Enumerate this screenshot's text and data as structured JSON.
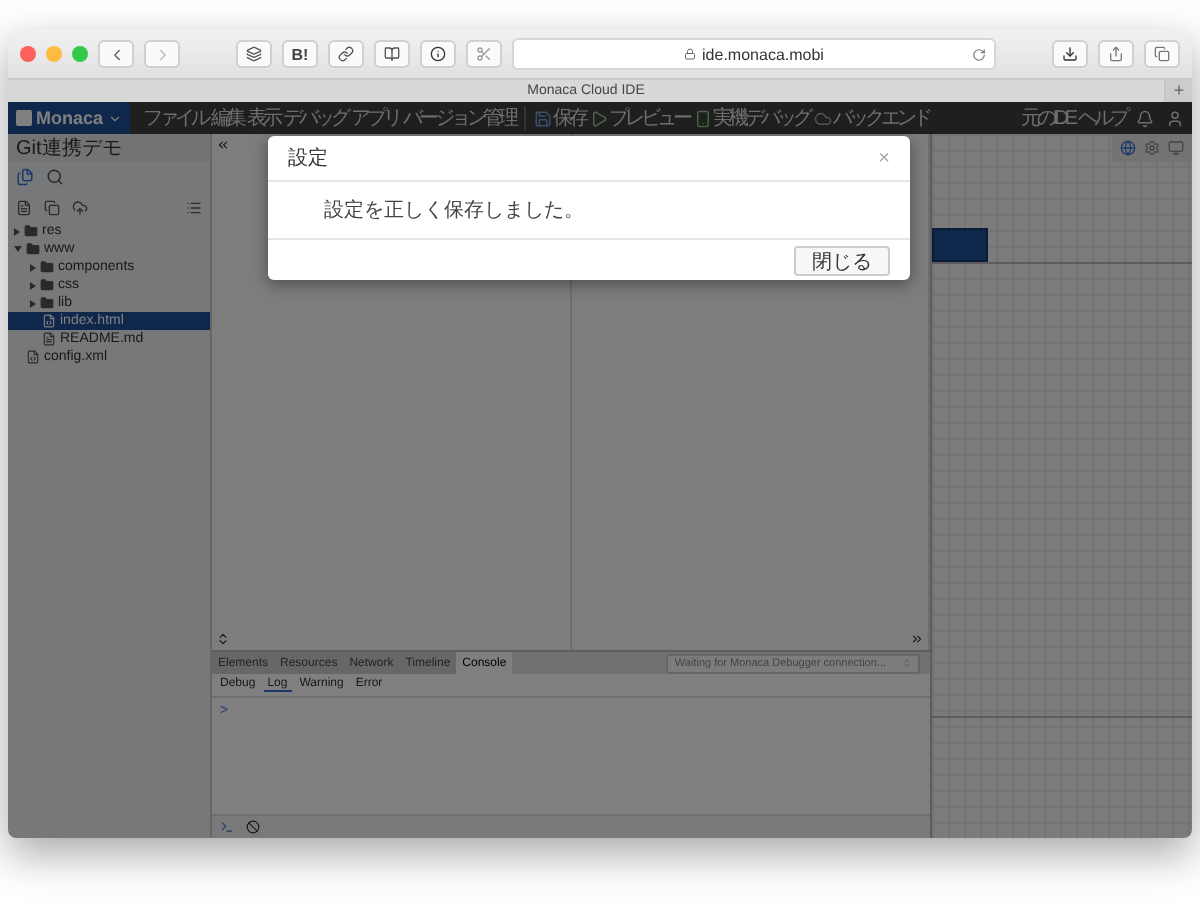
{
  "browser": {
    "toolbar_text": "B!",
    "url": "ide.monaca.mobi",
    "tab_title": "Monaca Cloud IDE",
    "new_tab": "+"
  },
  "app": {
    "logo": "Monaca",
    "menu": [
      "ファイル",
      "編集",
      "表示",
      "デバッグ",
      "アプリ",
      "バージョン管理"
    ],
    "actions": [
      {
        "label": "保存",
        "kind": "save"
      },
      {
        "label": "プレビュー",
        "kind": "preview"
      },
      {
        "label": "実機デバッグ",
        "kind": "device"
      },
      {
        "label": "バックエンド",
        "kind": "backend"
      }
    ],
    "links": [
      "元のIDE",
      "ヘルプ"
    ]
  },
  "sidebar": {
    "project": "Git連携デモ",
    "tree": [
      {
        "name": "res",
        "kind": "folder",
        "expanded": false,
        "selected": false
      },
      {
        "name": "www",
        "kind": "folder",
        "expanded": true,
        "selected": false,
        "children": [
          {
            "name": "components",
            "kind": "folder",
            "expanded": false,
            "selected": false
          },
          {
            "name": "css",
            "kind": "folder",
            "expanded": false,
            "selected": false
          },
          {
            "name": "lib",
            "kind": "folder",
            "expanded": false,
            "selected": false
          },
          {
            "name": "index.html",
            "kind": "file",
            "selected": true
          },
          {
            "name": "README.md",
            "kind": "markdown",
            "selected": false
          }
        ]
      },
      {
        "name": "config.xml",
        "kind": "file",
        "selected": false
      }
    ]
  },
  "console": {
    "tabs": [
      {
        "label": "Elements",
        "selected": false
      },
      {
        "label": "Resources",
        "selected": false
      },
      {
        "label": "Network",
        "selected": false
      },
      {
        "label": "Timeline",
        "selected": false
      },
      {
        "label": "Console",
        "selected": true
      }
    ],
    "status": "Waiting for Monaca Debugger connection...",
    "levels": [
      {
        "label": "Debug",
        "selected": false
      },
      {
        "label": "Log",
        "selected": true
      },
      {
        "label": "Warning",
        "selected": false
      },
      {
        "label": "Error",
        "selected": false
      }
    ],
    "prompt": ">"
  },
  "dialog": {
    "title": "設定",
    "close": "×",
    "message": "設定を正しく保存しました。",
    "button": "閉じる"
  }
}
